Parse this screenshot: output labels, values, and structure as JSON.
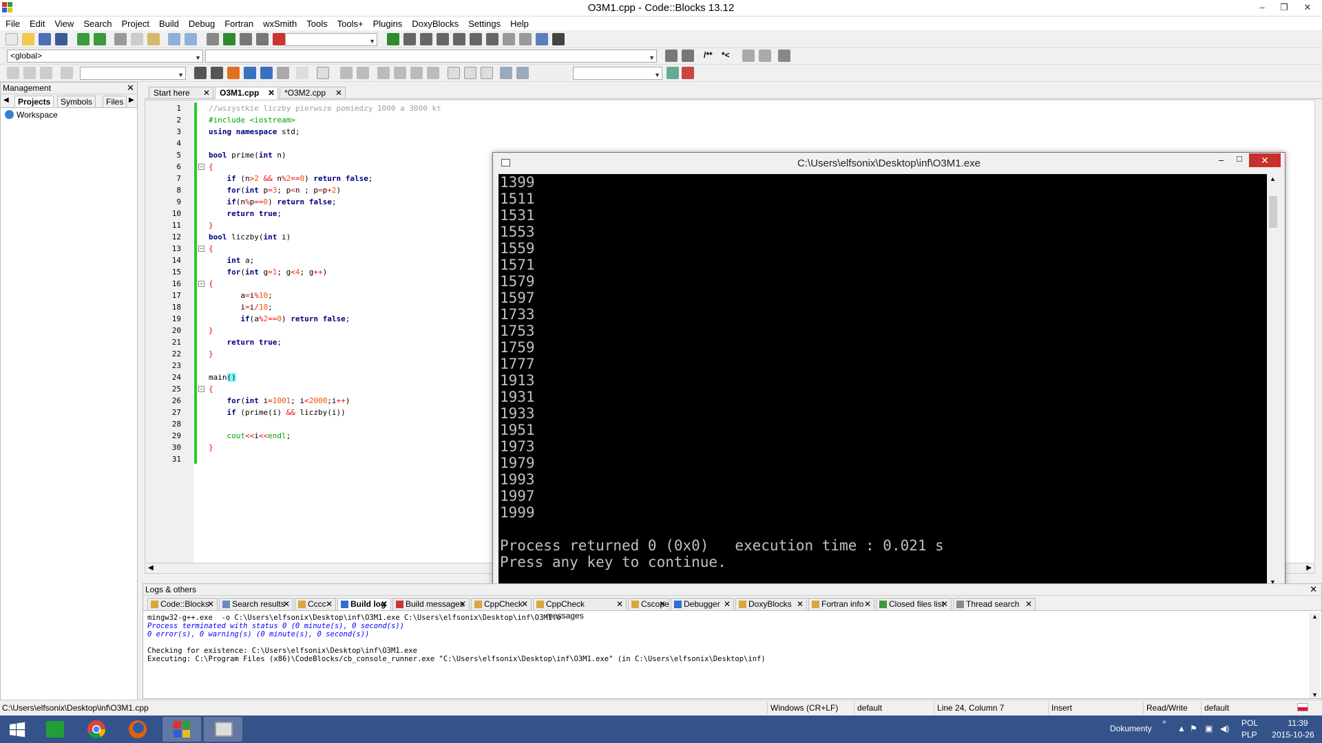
{
  "window": {
    "title": "O3M1.cpp - Code::Blocks 13.12",
    "minimize": "–",
    "maximize": "❐",
    "close": "✕"
  },
  "menu": [
    "File",
    "Edit",
    "View",
    "Search",
    "Project",
    "Build",
    "Debug",
    "Fortran",
    "wxSmith",
    "Tools",
    "Tools+",
    "Plugins",
    "DoxyBlocks",
    "Settings",
    "Help"
  ],
  "toolbar": {
    "scope_select": "<global>",
    "doxy_comment_labels": [
      "/**",
      "*<"
    ]
  },
  "management": {
    "title": "Management",
    "tabs": [
      "Projects",
      "Symbols",
      "Files"
    ],
    "active_tab": "Projects",
    "workspace": "Workspace"
  },
  "editor": {
    "tabs": [
      "Start here",
      "O3M1.cpp",
      "*O3M2.cpp"
    ],
    "active_tab": "O3M1.cpp",
    "line_numbers": [
      "1",
      "2",
      "3",
      "4",
      "5",
      "6",
      "7",
      "8",
      "9",
      "10",
      "11",
      "12",
      "13",
      "14",
      "15",
      "16",
      "17",
      "18",
      "19",
      "20",
      "21",
      "22",
      "23",
      "24",
      "25",
      "26",
      "27",
      "28",
      "29",
      "30",
      "31"
    ]
  },
  "console": {
    "title": "C:\\Users\\elfsonix\\Desktop\\inf\\O3M1.exe",
    "output": [
      "1399",
      "1511",
      "1531",
      "1553",
      "1559",
      "1571",
      "1579",
      "1597",
      "1733",
      "1753",
      "1759",
      "1777",
      "1913",
      "1931",
      "1933",
      "1951",
      "1973",
      "1979",
      "1993",
      "1997",
      "1999",
      "",
      "Process returned 0 (0x0)   execution time : 0.021 s",
      "Press any key to continue."
    ],
    "minimize": "–",
    "maximize": "□",
    "close": "✕"
  },
  "logs": {
    "title": "Logs & others",
    "tabs": [
      "Code::Blocks",
      "Search results",
      "Cccc",
      "Build log",
      "Build messages",
      "CppCheck",
      "CppCheck messages",
      "Cscope",
      "Debugger",
      "DoxyBlocks",
      "Fortran info",
      "Closed files list",
      "Thread search"
    ],
    "active_tab": "Build log",
    "lines": [
      "mingw32-g++.exe  -o C:\\Users\\elfsonix\\Desktop\\inf\\O3M1.exe C:\\Users\\elfsonix\\Desktop\\inf\\O3M1.o",
      "Process terminated with status 0 (0 minute(s), 0 second(s))",
      "0 error(s), 0 warning(s) (0 minute(s), 0 second(s))",
      "",
      "Checking for existence: C:\\Users\\elfsonix\\Desktop\\inf\\O3M1.exe",
      "Executing: C:\\Program Files (x86)\\CodeBlocks/cb_console_runner.exe \"C:\\Users\\elfsonix\\Desktop\\inf\\O3M1.exe\" (in C:\\Users\\elfsonix\\Desktop\\inf)"
    ]
  },
  "status": {
    "file_path": "C:\\Users\\elfsonix\\Desktop\\inf\\O3M1.cpp",
    "line_ending": "Windows (CR+LF)",
    "encoding": "default",
    "position": "Line 24, Column 7",
    "mode": "Insert",
    "access": "Read/Write",
    "lang": "default"
  },
  "taskbar": {
    "toolbar_name": "Dokumenty",
    "lang_top": "POL",
    "lang_bottom": "PLP",
    "time": "11:39",
    "date": "2015-10-26"
  }
}
